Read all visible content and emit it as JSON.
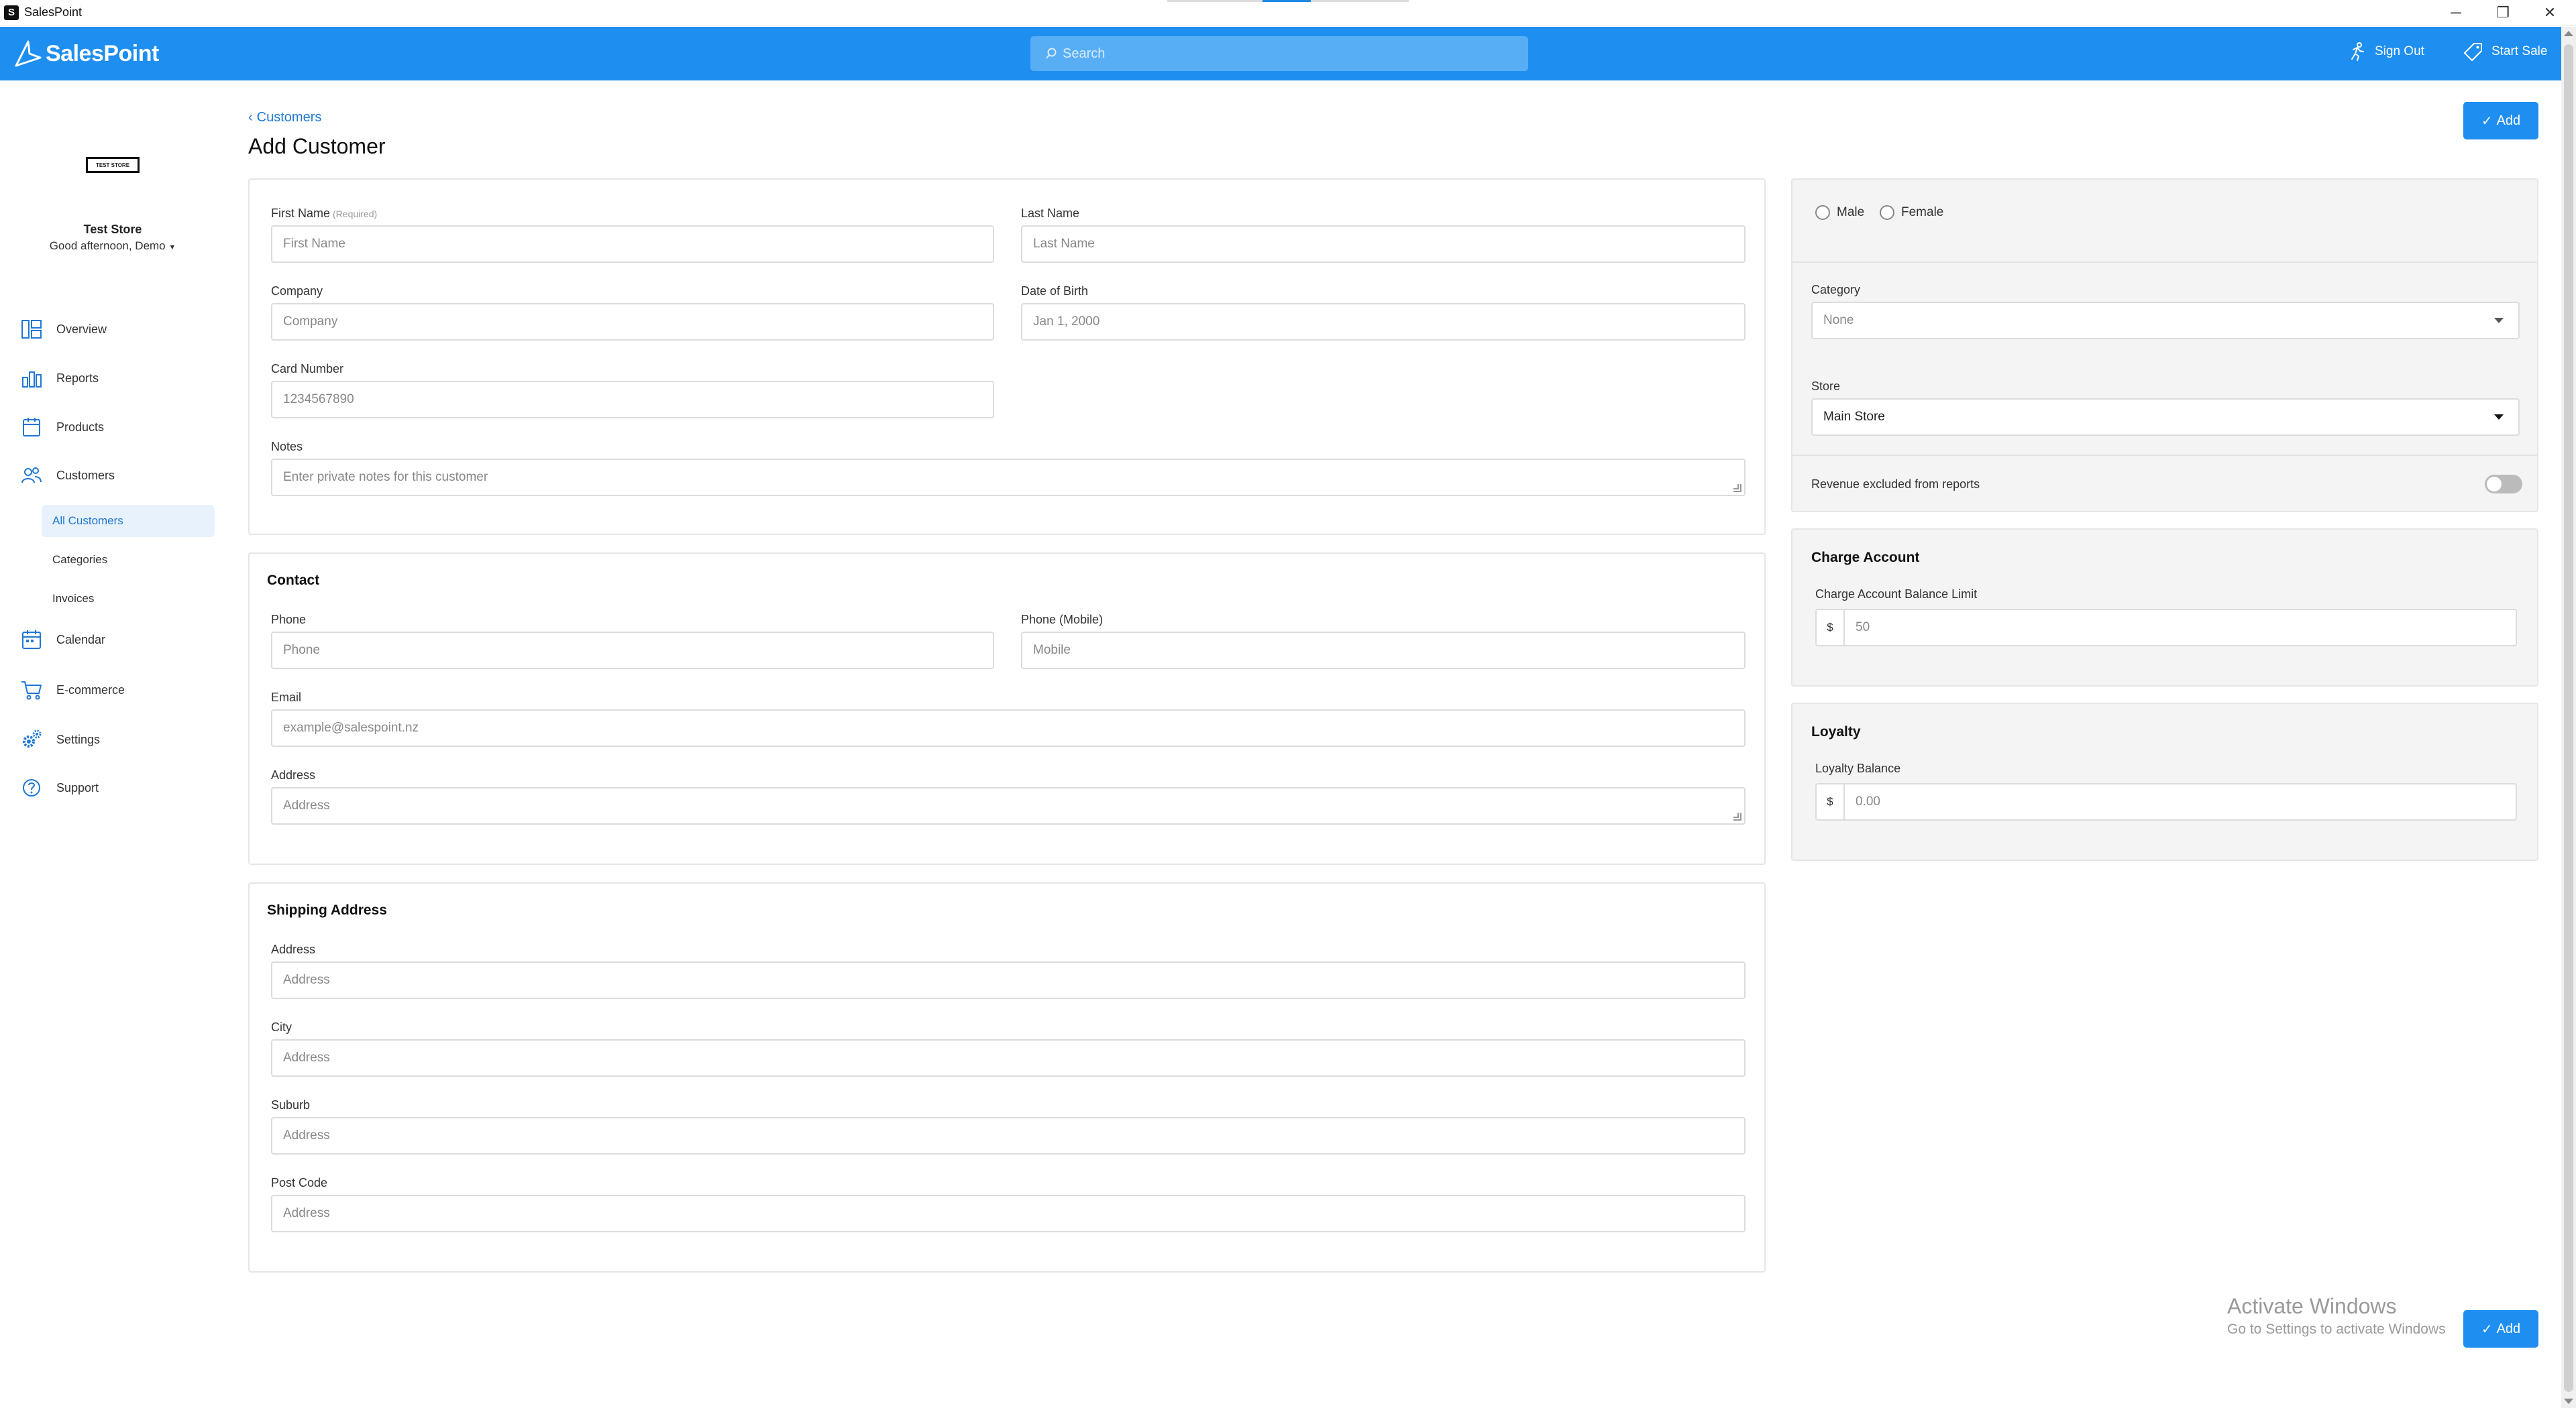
{
  "window": {
    "title": "SalesPoint",
    "minimize_glyph": "─",
    "restore_glyph": "❐",
    "close_glyph": "✕"
  },
  "header": {
    "logo_text": "SalesPoint",
    "search_placeholder": "Search",
    "sign_out_label": "Sign Out",
    "start_sale_label": "Start Sale",
    "brand_color": "#1e8ff0"
  },
  "sidebar": {
    "store_logo_text": "TEST STORE",
    "store_name": "Test Store",
    "greeting": "Good afternoon, Demo",
    "items": [
      {
        "label": "Overview",
        "icon": "overview-icon"
      },
      {
        "label": "Reports",
        "icon": "reports-icon"
      },
      {
        "label": "Products",
        "icon": "products-icon"
      },
      {
        "label": "Customers",
        "icon": "customers-icon"
      },
      {
        "label": "Calendar",
        "icon": "calendar-icon"
      },
      {
        "label": "E-commerce",
        "icon": "cart-icon"
      },
      {
        "label": "Settings",
        "icon": "gear-icon"
      },
      {
        "label": "Support",
        "icon": "help-icon"
      }
    ],
    "customer_subitems": [
      {
        "label": "All Customers",
        "active": true
      },
      {
        "label": "Categories",
        "active": false
      },
      {
        "label": "Invoices",
        "active": false
      }
    ]
  },
  "page": {
    "breadcrumb": "Customers",
    "title": "Add Customer",
    "add_button": "Add"
  },
  "details": {
    "first_name_label": "First Name",
    "first_name_required": "(Required)",
    "first_name_placeholder": "First Name",
    "last_name_label": "Last Name",
    "last_name_placeholder": "Last Name",
    "company_label": "Company",
    "company_placeholder": "Company",
    "dob_label": "Date of Birth",
    "dob_placeholder": "Jan 1, 2000",
    "card_number_label": "Card Number",
    "card_number_placeholder": "1234567890",
    "notes_label": "Notes",
    "notes_placeholder": "Enter private notes for this customer"
  },
  "contact": {
    "title": "Contact",
    "phone_label": "Phone",
    "phone_placeholder": "Phone",
    "mobile_label": "Phone (Mobile)",
    "mobile_placeholder": "Mobile",
    "email_label": "Email",
    "email_placeholder": "example@salespoint.nz",
    "address_label": "Address",
    "address_placeholder": "Address"
  },
  "shipping": {
    "title": "Shipping Address",
    "address_label": "Address",
    "address_placeholder": "Address",
    "city_label": "City",
    "city_placeholder": "Address",
    "suburb_label": "Suburb",
    "suburb_placeholder": "Address",
    "postcode_label": "Post Code",
    "postcode_placeholder": "Address"
  },
  "side_panel": {
    "gender_male": "Male",
    "gender_female": "Female",
    "category_label": "Category",
    "category_value": "None",
    "store_label": "Store",
    "store_value": "Main Store",
    "revenue_excluded_label": "Revenue excluded from reports",
    "revenue_excluded_on": false
  },
  "charge_account": {
    "title": "Charge Account",
    "limit_label": "Charge Account Balance Limit",
    "currency": "$",
    "limit_placeholder": "50"
  },
  "loyalty": {
    "title": "Loyalty",
    "balance_label": "Loyalty Balance",
    "currency": "$",
    "balance_placeholder": "0.00"
  },
  "watermark": {
    "line1": "Activate Windows",
    "line2": "Go to Settings to activate Windows"
  }
}
